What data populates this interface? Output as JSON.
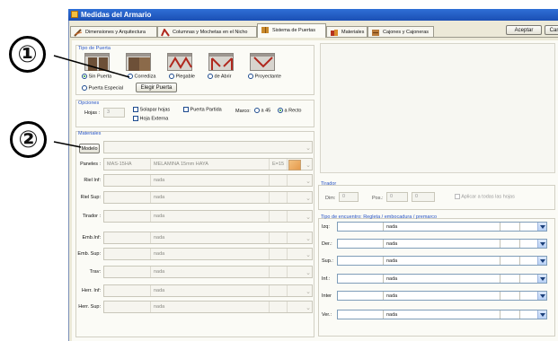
{
  "window": {
    "title": "Medidas del Armario"
  },
  "tabs": [
    {
      "label": "Dimensiones y Arquitectura"
    },
    {
      "label": "Columnas y Mochetas en el Nicho"
    },
    {
      "label": "Sistema de Puertas"
    },
    {
      "label": "Materiales"
    },
    {
      "label": "Cajones y Cajoneras"
    }
  ],
  "buttons": {
    "accept": "Aceptar",
    "cancel": "Cancel",
    "choose_door": "Elegir Puerta",
    "model": "Modelo"
  },
  "callouts": {
    "one": "①",
    "two": "②"
  },
  "door_type": {
    "title": "Tipo de Puerta",
    "options": [
      "Sin Puerta",
      "Corrediza",
      "Plegable",
      "de Abrir",
      "Proyectante",
      "Puerta Especial"
    ],
    "selected": "Sin Puerta"
  },
  "options": {
    "title": "Opciones",
    "hojas_label": "Hojas :",
    "hojas_value": "3",
    "solapar": "Solapar hojas",
    "puerta_partida": "Puerta Partida",
    "hoja_externa": "Hoja Externa",
    "marco_label": "Marco:",
    "marco_45": "a 45",
    "marco_recto": "a Recto",
    "marco_selected": "a Recto"
  },
  "materials": {
    "title": "Materiales",
    "rows": [
      {
        "label": "Paneles :",
        "code": "MAS-15HA",
        "name": "MELAMINA 15mm HAYA",
        "thick": "E=15"
      },
      {
        "label": "Riel Inf:",
        "code": "",
        "name": "nada",
        "thick": ""
      },
      {
        "label": "Riel Sup:",
        "code": "",
        "name": "nada",
        "thick": ""
      },
      {
        "label": "Tirador :",
        "code": "",
        "name": "nada",
        "thick": ""
      },
      {
        "label": "Emb.Inf:",
        "code": "",
        "name": "nada",
        "thick": ""
      },
      {
        "label": "Emb. Sup:",
        "code": "",
        "name": "nada",
        "thick": ""
      },
      {
        "label": "Trav:",
        "code": "",
        "name": "nada",
        "thick": ""
      },
      {
        "label": "Herr. Inf:",
        "code": "",
        "name": "nada",
        "thick": ""
      },
      {
        "label": "Herr. Sup:",
        "code": "",
        "name": "nada",
        "thick": ""
      }
    ]
  },
  "tirador": {
    "title": "Tirador",
    "dim_label": "Dim:",
    "dim_value": "0",
    "pos_label": "Pos.:",
    "pos_value1": "0",
    "pos_value2": "0",
    "apply_all": "Aplicar a todas las hojas"
  },
  "encounter": {
    "title": "Tipo de encuentro: Regleta / embocadura / premarco",
    "rows": [
      {
        "label": "Izq:",
        "value": "nada"
      },
      {
        "label": "Der.:",
        "value": "nada"
      },
      {
        "label": "Sup.:",
        "value": "nada"
      },
      {
        "label": "Inf.:",
        "value": "nada"
      },
      {
        "label": "Inter",
        "value": "nada"
      },
      {
        "label": "Ver.:",
        "value": "nada"
      }
    ]
  },
  "colors": {
    "titlebar": "#1b4fb4",
    "group_title": "#2a56c6",
    "dialog_bg": "#ece9d8",
    "radio_dot": "#2aa02a"
  }
}
